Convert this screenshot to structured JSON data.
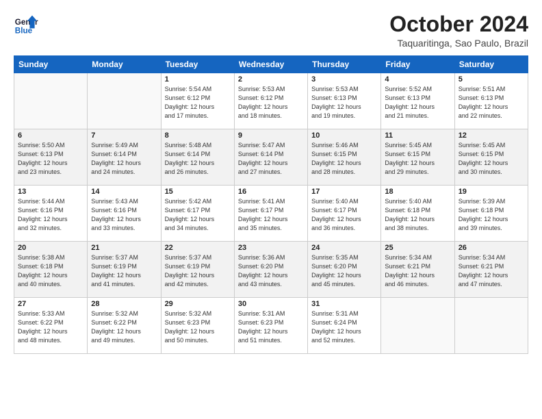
{
  "logo": {
    "line1": "General",
    "line2": "Blue"
  },
  "title": "October 2024",
  "subtitle": "Taquaritinga, Sao Paulo, Brazil",
  "days_header": [
    "Sunday",
    "Monday",
    "Tuesday",
    "Wednesday",
    "Thursday",
    "Friday",
    "Saturday"
  ],
  "weeks": [
    [
      {
        "num": "",
        "info": ""
      },
      {
        "num": "",
        "info": ""
      },
      {
        "num": "1",
        "info": "Sunrise: 5:54 AM\nSunset: 6:12 PM\nDaylight: 12 hours\nand 17 minutes."
      },
      {
        "num": "2",
        "info": "Sunrise: 5:53 AM\nSunset: 6:12 PM\nDaylight: 12 hours\nand 18 minutes."
      },
      {
        "num": "3",
        "info": "Sunrise: 5:53 AM\nSunset: 6:13 PM\nDaylight: 12 hours\nand 19 minutes."
      },
      {
        "num": "4",
        "info": "Sunrise: 5:52 AM\nSunset: 6:13 PM\nDaylight: 12 hours\nand 21 minutes."
      },
      {
        "num": "5",
        "info": "Sunrise: 5:51 AM\nSunset: 6:13 PM\nDaylight: 12 hours\nand 22 minutes."
      }
    ],
    [
      {
        "num": "6",
        "info": "Sunrise: 5:50 AM\nSunset: 6:13 PM\nDaylight: 12 hours\nand 23 minutes."
      },
      {
        "num": "7",
        "info": "Sunrise: 5:49 AM\nSunset: 6:14 PM\nDaylight: 12 hours\nand 24 minutes."
      },
      {
        "num": "8",
        "info": "Sunrise: 5:48 AM\nSunset: 6:14 PM\nDaylight: 12 hours\nand 26 minutes."
      },
      {
        "num": "9",
        "info": "Sunrise: 5:47 AM\nSunset: 6:14 PM\nDaylight: 12 hours\nand 27 minutes."
      },
      {
        "num": "10",
        "info": "Sunrise: 5:46 AM\nSunset: 6:15 PM\nDaylight: 12 hours\nand 28 minutes."
      },
      {
        "num": "11",
        "info": "Sunrise: 5:45 AM\nSunset: 6:15 PM\nDaylight: 12 hours\nand 29 minutes."
      },
      {
        "num": "12",
        "info": "Sunrise: 5:45 AM\nSunset: 6:15 PM\nDaylight: 12 hours\nand 30 minutes."
      }
    ],
    [
      {
        "num": "13",
        "info": "Sunrise: 5:44 AM\nSunset: 6:16 PM\nDaylight: 12 hours\nand 32 minutes."
      },
      {
        "num": "14",
        "info": "Sunrise: 5:43 AM\nSunset: 6:16 PM\nDaylight: 12 hours\nand 33 minutes."
      },
      {
        "num": "15",
        "info": "Sunrise: 5:42 AM\nSunset: 6:17 PM\nDaylight: 12 hours\nand 34 minutes."
      },
      {
        "num": "16",
        "info": "Sunrise: 5:41 AM\nSunset: 6:17 PM\nDaylight: 12 hours\nand 35 minutes."
      },
      {
        "num": "17",
        "info": "Sunrise: 5:40 AM\nSunset: 6:17 PM\nDaylight: 12 hours\nand 36 minutes."
      },
      {
        "num": "18",
        "info": "Sunrise: 5:40 AM\nSunset: 6:18 PM\nDaylight: 12 hours\nand 38 minutes."
      },
      {
        "num": "19",
        "info": "Sunrise: 5:39 AM\nSunset: 6:18 PM\nDaylight: 12 hours\nand 39 minutes."
      }
    ],
    [
      {
        "num": "20",
        "info": "Sunrise: 5:38 AM\nSunset: 6:18 PM\nDaylight: 12 hours\nand 40 minutes."
      },
      {
        "num": "21",
        "info": "Sunrise: 5:37 AM\nSunset: 6:19 PM\nDaylight: 12 hours\nand 41 minutes."
      },
      {
        "num": "22",
        "info": "Sunrise: 5:37 AM\nSunset: 6:19 PM\nDaylight: 12 hours\nand 42 minutes."
      },
      {
        "num": "23",
        "info": "Sunrise: 5:36 AM\nSunset: 6:20 PM\nDaylight: 12 hours\nand 43 minutes."
      },
      {
        "num": "24",
        "info": "Sunrise: 5:35 AM\nSunset: 6:20 PM\nDaylight: 12 hours\nand 45 minutes."
      },
      {
        "num": "25",
        "info": "Sunrise: 5:34 AM\nSunset: 6:21 PM\nDaylight: 12 hours\nand 46 minutes."
      },
      {
        "num": "26",
        "info": "Sunrise: 5:34 AM\nSunset: 6:21 PM\nDaylight: 12 hours\nand 47 minutes."
      }
    ],
    [
      {
        "num": "27",
        "info": "Sunrise: 5:33 AM\nSunset: 6:22 PM\nDaylight: 12 hours\nand 48 minutes."
      },
      {
        "num": "28",
        "info": "Sunrise: 5:32 AM\nSunset: 6:22 PM\nDaylight: 12 hours\nand 49 minutes."
      },
      {
        "num": "29",
        "info": "Sunrise: 5:32 AM\nSunset: 6:23 PM\nDaylight: 12 hours\nand 50 minutes."
      },
      {
        "num": "30",
        "info": "Sunrise: 5:31 AM\nSunset: 6:23 PM\nDaylight: 12 hours\nand 51 minutes."
      },
      {
        "num": "31",
        "info": "Sunrise: 5:31 AM\nSunset: 6:24 PM\nDaylight: 12 hours\nand 52 minutes."
      },
      {
        "num": "",
        "info": ""
      },
      {
        "num": "",
        "info": ""
      }
    ]
  ]
}
